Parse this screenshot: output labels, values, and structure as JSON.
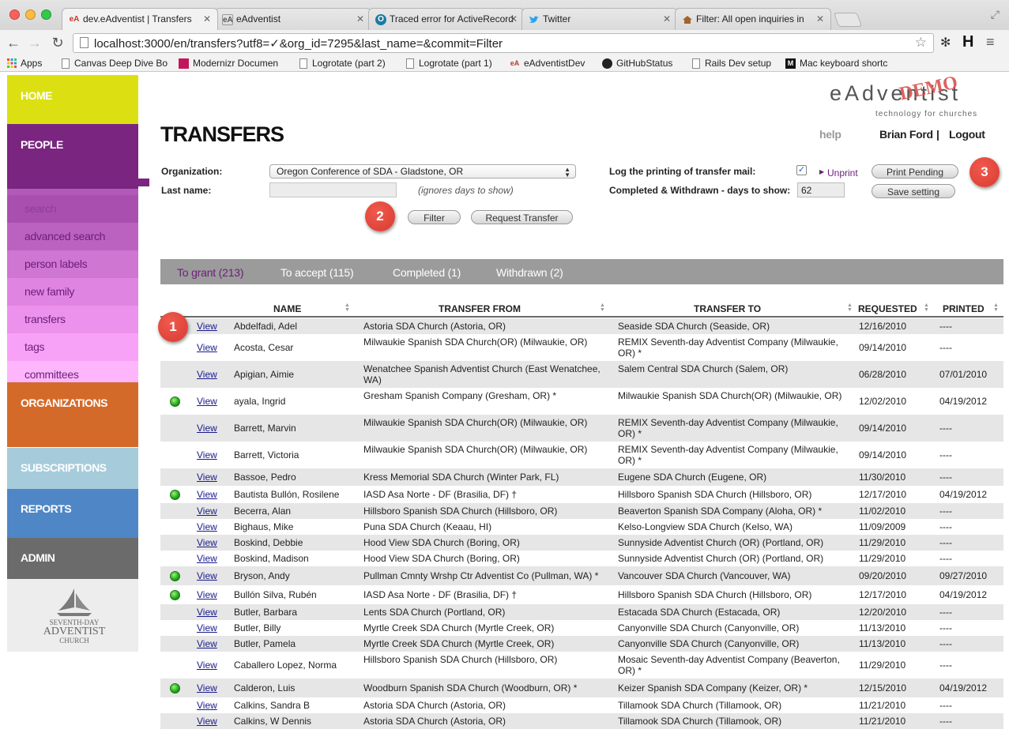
{
  "browser": {
    "tabs": [
      {
        "label": "dev.eAdventist | Transfers",
        "favicon": "eA",
        "active": true
      },
      {
        "label": "eAdventist",
        "favicon": "eA",
        "active": false
      },
      {
        "label": "Traced error for ActiveRecord",
        "favicon": "O",
        "active": false
      },
      {
        "label": "Twitter",
        "favicon": "twitter-bird",
        "active": false
      },
      {
        "label": "Filter: All open inquiries in",
        "favicon": "house",
        "active": false
      }
    ],
    "url": "localhost:3000/en/transfers?utf8=✓&org_id=7295&last_name=&commit=Filter",
    "bookmarks": [
      "Apps",
      "Canvas Deep Dive Bo",
      "Modernizr Documen",
      "Logrotate (part 2)",
      "Logrotate (part 1)",
      "eAdventistDev",
      "GitHubStatus",
      "Rails Dev setup",
      "Mac keyboard shortc"
    ]
  },
  "nav": {
    "home": "HOME",
    "people": "PEOPLE",
    "people_items": [
      "search",
      "advanced search",
      "person labels",
      "new family",
      "transfers",
      "tags",
      "committees"
    ],
    "organizations": "ORGANIZATIONS",
    "subscriptions": "SUBSCRIPTIONS",
    "reports": "REPORTS",
    "admin": "ADMIN",
    "logo_line1": "SEVENTH-DAY",
    "logo_line2": "ADVENTIST",
    "logo_line3": "CHURCH",
    "colors": {
      "home": "#dce012",
      "people": "#7a2580",
      "organizations": "#d46a2a",
      "subscriptions": "#a6ccdb",
      "reports": "#4f86c6",
      "admin": "#6b6b6b"
    }
  },
  "header": {
    "brand": "eAdventist",
    "brand_demo": "DEMO",
    "brand_tagline": "technology for churches",
    "help": "help",
    "user": "Brian Ford",
    "separator": "|",
    "logout": "Logout"
  },
  "page": {
    "title": "TRANSFERS"
  },
  "filters": {
    "organization_label": "Organization:",
    "organization_value": "Oregon Conference of SDA - Gladstone, OR",
    "last_name_label": "Last name:",
    "last_name_value": "",
    "ignores_note": "(ignores days to show)",
    "filter_button": "Filter",
    "request_button": "Request Transfer",
    "log_label": "Log the printing of transfer mail:",
    "log_checked": "✓",
    "unprint": "Unprint",
    "print_pending": "Print Pending",
    "days_label": "Completed & Withdrawn - days to show:",
    "days_value": "62",
    "save_setting": "Save setting"
  },
  "callouts": [
    "1",
    "2",
    "3"
  ],
  "tabs": [
    {
      "label": "To grant (213)",
      "active": true
    },
    {
      "label": "To accept (115)",
      "active": false
    },
    {
      "label": "Completed (1)",
      "active": false
    },
    {
      "label": "Withdrawn (2)",
      "active": false
    }
  ],
  "table": {
    "headers": [
      "NAME",
      "TRANSFER FROM",
      "TRANSFER TO",
      "REQUESTED",
      "PRINTED"
    ],
    "view_label": "View",
    "rows": [
      {
        "printed_flag": false,
        "name": "Abdelfadi, Adel",
        "from": "Astoria SDA Church (Astoria, OR)",
        "to": "Seaside SDA Church (Seaside, OR)",
        "requested": "12/16/2010",
        "printed": "----"
      },
      {
        "printed_flag": false,
        "name": "Acosta, Cesar",
        "from": "Milwaukie Spanish SDA Church(OR) (Milwaukie, OR)",
        "to": "REMIX Seventh-day Adventist Company (Milwaukie, OR) *",
        "requested": "09/14/2010",
        "printed": "----"
      },
      {
        "printed_flag": false,
        "name": "Apigian, Aimie",
        "from": "Wenatchee Spanish Adventist Church (East Wenatchee, WA)",
        "to": "Salem Central SDA Church (Salem, OR)",
        "requested": "06/28/2010",
        "printed": "07/01/2010"
      },
      {
        "printed_flag": true,
        "name": "ayala, Ingrid",
        "from": "Gresham Spanish Company (Gresham, OR) *",
        "to": "Milwaukie Spanish SDA Church(OR) (Milwaukie, OR)",
        "requested": "12/02/2010",
        "printed": "04/19/2012"
      },
      {
        "printed_flag": false,
        "name": "Barrett, Marvin",
        "from": "Milwaukie Spanish SDA Church(OR) (Milwaukie, OR)",
        "to": "REMIX Seventh-day Adventist Company (Milwaukie, OR) *",
        "requested": "09/14/2010",
        "printed": "----"
      },
      {
        "printed_flag": false,
        "name": "Barrett, Victoria",
        "from": "Milwaukie Spanish SDA Church(OR) (Milwaukie, OR)",
        "to": "REMIX Seventh-day Adventist Company (Milwaukie, OR) *",
        "requested": "09/14/2010",
        "printed": "----"
      },
      {
        "printed_flag": false,
        "name": "Bassoe, Pedro",
        "from": "Kress Memorial SDA Church (Winter Park, FL)",
        "to": "Eugene SDA Church (Eugene, OR)",
        "requested": "11/30/2010",
        "printed": "----"
      },
      {
        "printed_flag": true,
        "name": "Bautista Bullón, Rosilene",
        "from": "IASD Asa Norte - DF (Brasilia, DF) †",
        "to": "Hillsboro Spanish SDA Church (Hillsboro, OR)",
        "requested": "12/17/2010",
        "printed": "04/19/2012"
      },
      {
        "printed_flag": false,
        "name": "Becerra, Alan",
        "from": "Hillsboro Spanish SDA Church (Hillsboro, OR)",
        "to": "Beaverton Spanish SDA Company (Aloha, OR) *",
        "requested": "11/02/2010",
        "printed": "----"
      },
      {
        "printed_flag": false,
        "name": "Bighaus, Mike",
        "from": "Puna SDA Church (Keaau, HI)",
        "to": "Kelso-Longview SDA Church (Kelso, WA)",
        "requested": "11/09/2009",
        "printed": "----"
      },
      {
        "printed_flag": false,
        "name": "Boskind, Debbie",
        "from": "Hood View SDA Church (Boring, OR)",
        "to": "Sunnyside Adventist Church (OR) (Portland, OR)",
        "requested": "11/29/2010",
        "printed": "----"
      },
      {
        "printed_flag": false,
        "name": "Boskind, Madison",
        "from": "Hood View SDA Church (Boring, OR)",
        "to": "Sunnyside Adventist Church (OR) (Portland, OR)",
        "requested": "11/29/2010",
        "printed": "----"
      },
      {
        "printed_flag": true,
        "name": "Bryson, Andy",
        "from": "Pullman Cmnty Wrshp Ctr Adventist Co (Pullman, WA) *",
        "to": "Vancouver SDA Church (Vancouver, WA)",
        "requested": "09/20/2010",
        "printed": "09/27/2010"
      },
      {
        "printed_flag": true,
        "name": "Bullón Silva, Rubén",
        "from": "IASD Asa Norte - DF (Brasilia, DF) †",
        "to": "Hillsboro Spanish SDA Church (Hillsboro, OR)",
        "requested": "12/17/2010",
        "printed": "04/19/2012"
      },
      {
        "printed_flag": false,
        "name": "Butler, Barbara",
        "from": "Lents SDA Church (Portland, OR)",
        "to": "Estacada SDA Church (Estacada, OR)",
        "requested": "12/20/2010",
        "printed": "----"
      },
      {
        "printed_flag": false,
        "name": "Butler, Billy",
        "from": "Myrtle Creek SDA Church (Myrtle Creek, OR)",
        "to": "Canyonville SDA Church (Canyonville, OR)",
        "requested": "11/13/2010",
        "printed": "----"
      },
      {
        "printed_flag": false,
        "name": "Butler, Pamela",
        "from": "Myrtle Creek SDA Church (Myrtle Creek, OR)",
        "to": "Canyonville SDA Church (Canyonville, OR)",
        "requested": "11/13/2010",
        "printed": "----"
      },
      {
        "printed_flag": false,
        "name": "Caballero Lopez, Norma",
        "from": "Hillsboro Spanish SDA Church (Hillsboro, OR)",
        "to": "Mosaic Seventh-day Adventist Company (Beaverton, OR) *",
        "requested": "11/29/2010",
        "printed": "----"
      },
      {
        "printed_flag": true,
        "name": "Calderon, Luis",
        "from": "Woodburn Spanish SDA Church (Woodburn, OR) *",
        "to": "Keizer Spanish SDA Company (Keizer, OR) *",
        "requested": "12/15/2010",
        "printed": "04/19/2012"
      },
      {
        "printed_flag": false,
        "name": "Calkins, Sandra B",
        "from": "Astoria SDA Church (Astoria, OR)",
        "to": "Tillamook SDA Church (Tillamook, OR)",
        "requested": "11/21/2010",
        "printed": "----"
      },
      {
        "printed_flag": false,
        "name": "Calkins, W Dennis",
        "from": "Astoria SDA Church (Astoria, OR)",
        "to": "Tillamook SDA Church (Tillamook, OR)",
        "requested": "11/21/2010",
        "printed": "----"
      }
    ]
  }
}
